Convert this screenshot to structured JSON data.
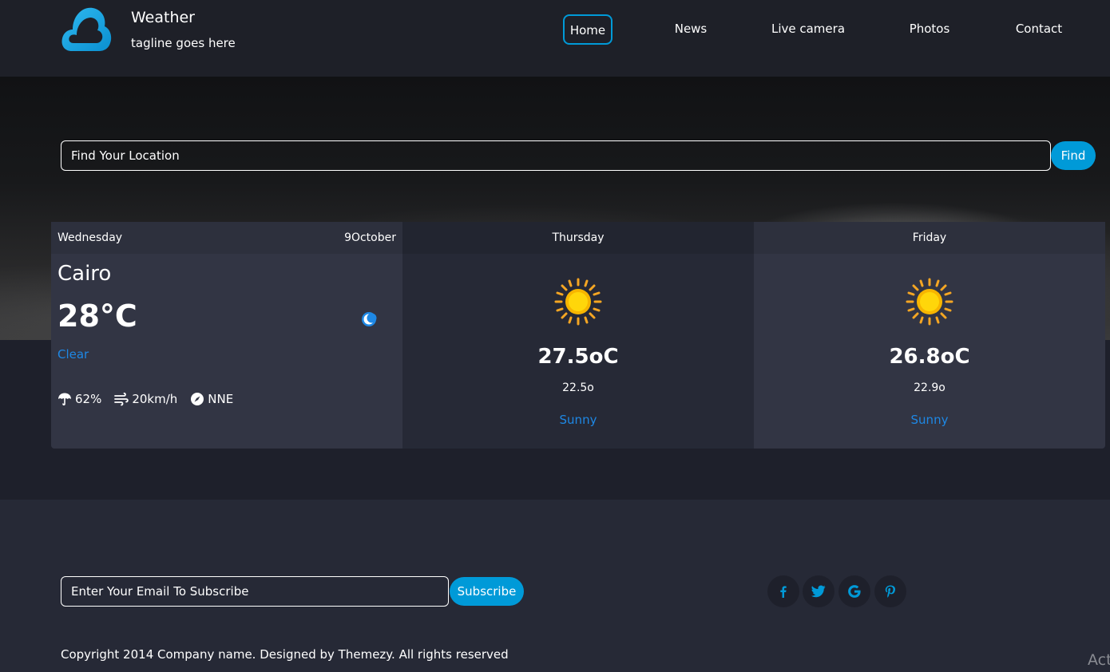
{
  "header": {
    "title": "Weather",
    "tagline": "tagline goes here",
    "logo_icon": "cloud-logo-icon"
  },
  "nav": {
    "items": [
      {
        "label": "Home",
        "active": true
      },
      {
        "label": "News"
      },
      {
        "label": "Live camera"
      },
      {
        "label": "Photos"
      },
      {
        "label": "Contact"
      }
    ]
  },
  "search": {
    "placeholder": "Find Your Location",
    "button_label": "Find"
  },
  "today": {
    "day": "Wednesday",
    "date": "9October",
    "city": "Cairo",
    "temperature": "28°C",
    "condition": "Clear",
    "condition_icon": "moon-icon",
    "humidity": "62%",
    "wind_speed": "20km/h",
    "wind_direction": "NNE"
  },
  "forecast": [
    {
      "day": "Thursday",
      "max": "27.5oC",
      "min": "22.5o",
      "condition": "Sunny",
      "icon": "sun-icon"
    },
    {
      "day": "Friday",
      "max": "26.8oC",
      "min": "22.9o",
      "condition": "Sunny",
      "icon": "sun-icon"
    }
  ],
  "footer": {
    "email_placeholder": "Enter Your Email To Subscribe",
    "subscribe_label": "Subscribe",
    "social": [
      "facebook-icon",
      "twitter-icon",
      "google-icon",
      "pinterest-icon"
    ],
    "copyright": "Copyright 2014 Company name. Designed by Themezy. All rights reserved",
    "watermark": "Act"
  },
  "colors": {
    "accent": "#009ad8",
    "condition_text": "#1e88e5",
    "card_bg": "#323544",
    "page_bg": "#1e202b"
  }
}
